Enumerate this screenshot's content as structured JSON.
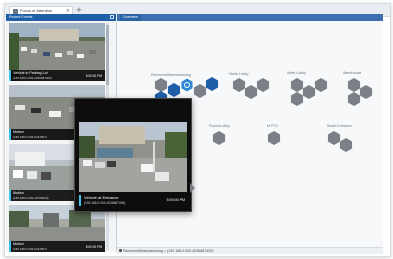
{
  "tab": {
    "title": "Focus of Attention",
    "close": "×",
    "add": "+"
  },
  "left_panel": {
    "title": "Recent Events"
  },
  "overview": {
    "title": "Overview"
  },
  "events": [
    {
      "title": "Vehicle in Parking Lot",
      "subtitle": "(186.168.0.003-4036687400)",
      "time": "5:00:00 PM"
    },
    {
      "title": "Motion",
      "subtitle": "(186.168.0.004-6234567)",
      "time": "5:00:00 PM"
    },
    {
      "title": "Motion",
      "subtitle": "(186.168.0.003-46789320)",
      "time": "5:00:00 PM"
    },
    {
      "title": "Motion",
      "subtitle": "(186.168.0.004-6234567)",
      "time": "5:00:00 PM"
    }
  ],
  "popup": {
    "title": "Vehicle at Entrance",
    "subtitle": "(192.168.0.003-4036687400)",
    "time": "5:00:00 PM"
  },
  "groups": [
    {
      "label": "Richmond/Manufacturing"
    },
    {
      "label": "North Lobby"
    },
    {
      "label": "West Lobby"
    },
    {
      "label": "Warehouse"
    },
    {
      "label": "Floors/Lobby"
    },
    {
      "label": "M PTZ"
    },
    {
      "label": "South Entrance"
    }
  ],
  "status": {
    "path": "Richmond/Manufacturing > (192.168.0.003-4036687400)"
  },
  "colors": {
    "hex_default": "#7b8087",
    "hex_active": "#1f5fa8",
    "hex_selected": "#2e86d6",
    "accent": "#3fc3e6"
  }
}
